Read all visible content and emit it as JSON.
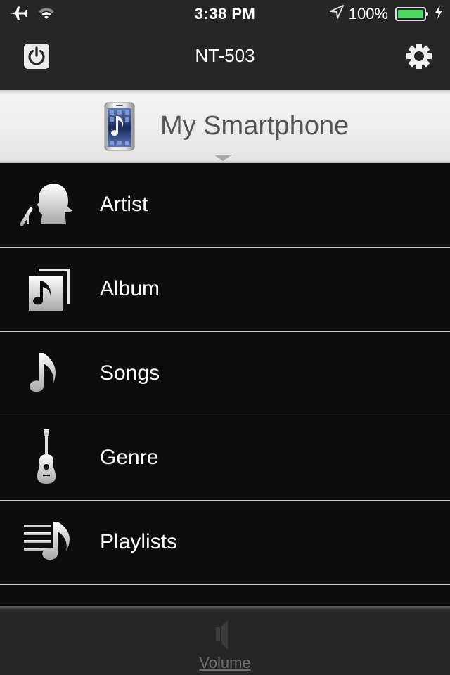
{
  "status_bar": {
    "time": "3:38 PM",
    "battery_percent_label": "100%",
    "battery_level": 1.0,
    "battery_color": "#4cd964",
    "icons": [
      "airplane-icon",
      "wifi-icon",
      "location-arrow-icon",
      "battery-icon",
      "charging-bolt-icon"
    ]
  },
  "nav": {
    "title": "NT-503",
    "left_button": "power-icon",
    "right_button": "gear-icon"
  },
  "source": {
    "label": "My Smartphone",
    "icon": "smartphone-music-icon"
  },
  "menu": {
    "items": [
      {
        "label": "Artist",
        "icon": "artist-singer-icon"
      },
      {
        "label": "Album",
        "icon": "album-icon"
      },
      {
        "label": "Songs",
        "icon": "music-note-icon"
      },
      {
        "label": "Genre",
        "icon": "guitar-icon"
      },
      {
        "label": "Playlists",
        "icon": "playlist-icon"
      }
    ]
  },
  "bottom": {
    "volume_label": "Volume",
    "volume_icon": "speaker-icon"
  }
}
